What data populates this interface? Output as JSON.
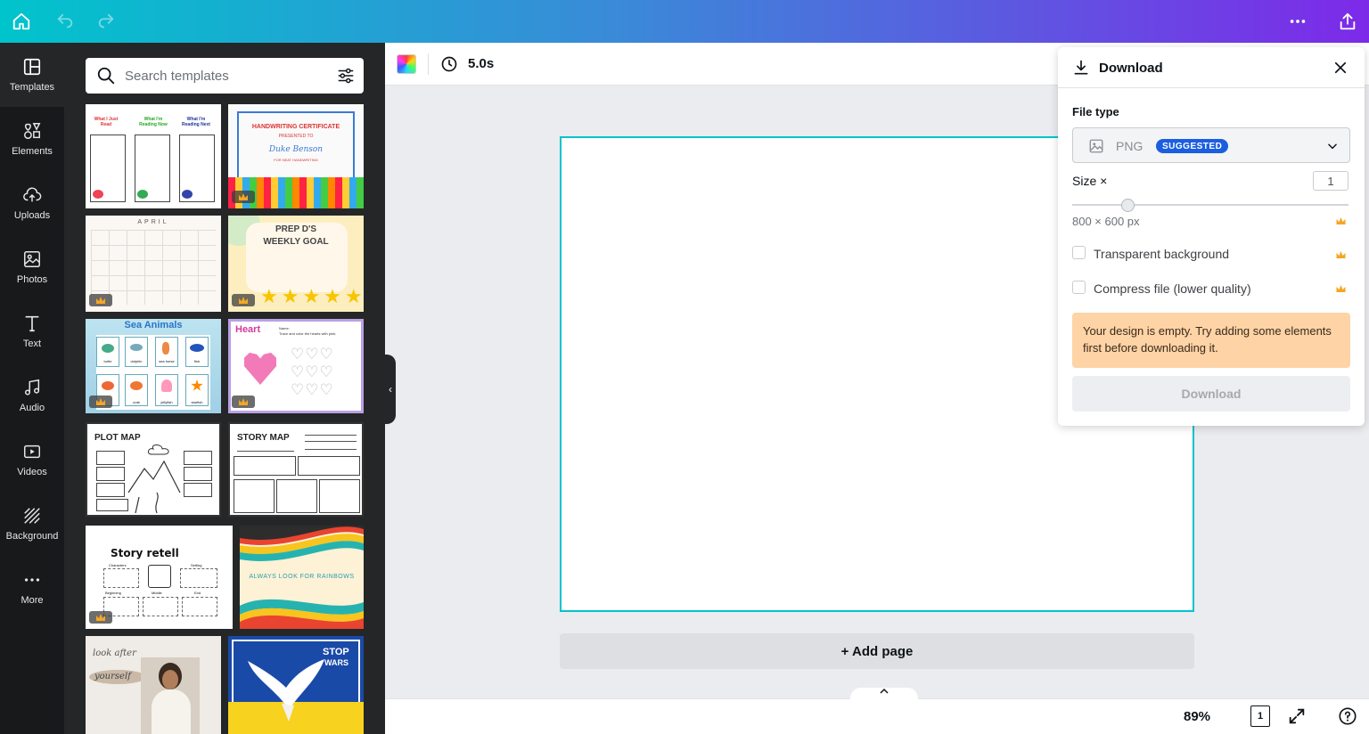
{
  "topbar": {
    "icons": [
      "home-icon",
      "undo-icon",
      "redo-icon",
      "more-icon",
      "share-icon"
    ]
  },
  "rail": {
    "items": [
      {
        "label": "Templates",
        "icon": "templates-icon",
        "active": true
      },
      {
        "label": "Elements",
        "icon": "elements-icon"
      },
      {
        "label": "Uploads",
        "icon": "uploads-icon"
      },
      {
        "label": "Photos",
        "icon": "photos-icon"
      },
      {
        "label": "Text",
        "icon": "text-icon"
      },
      {
        "label": "Audio",
        "icon": "audio-icon"
      },
      {
        "label": "Videos",
        "icon": "videos-icon"
      },
      {
        "label": "Background",
        "icon": "background-icon"
      },
      {
        "label": "More",
        "icon": "more-icon"
      }
    ]
  },
  "search": {
    "placeholder": "Search templates"
  },
  "templates": {
    "reading": {
      "col1": "What I Just Read",
      "col2": "What I'm Reading Now",
      "col3": "What I'm Reading Next"
    },
    "certificate": {
      "title": "HANDWRITING CERTIFICATE",
      "sub": "PRESENTED TO",
      "name": "Duke Benson",
      "reason": "FOR NEAT HANDWRITING"
    },
    "calendar": {
      "month": "APRIL"
    },
    "weekly": {
      "title1": "PREP D'S",
      "title2": "WEEKLY GOAL"
    },
    "sea": {
      "title": "Sea Animals",
      "labels": [
        "turtle",
        "dolphin",
        "sea horse",
        "fish",
        "crab",
        "crab",
        "jellyfish",
        "starfish"
      ]
    },
    "heart": {
      "title": "Heart",
      "instruction": "Trace and color the hearts with pink.",
      "name_label": "Name:"
    },
    "plotmap": {
      "title": "PLOT MAP"
    },
    "storymap": {
      "title": "STORY MAP"
    },
    "retell": {
      "title": "Story retell",
      "labels": [
        "Characters",
        "Setting",
        "Beginning",
        "Middle",
        "End"
      ]
    },
    "rainbow": {
      "text": "ALWAYS LOOK FOR RAINBOWS"
    },
    "lookafter": {
      "line1": "look after",
      "line2": "yourself"
    },
    "stopwars": {
      "line1": "STOP",
      "line2": "WARS"
    }
  },
  "editor": {
    "duration": "5.0s",
    "add_page": "+ Add page",
    "zoom": "89%",
    "page_count": "1"
  },
  "download": {
    "title": "Download",
    "file_type_label": "File type",
    "file_type_value": "PNG",
    "suggested_badge": "SUGGESTED",
    "size_label": "Size ×",
    "size_value": "1",
    "size_fraction": 0.2,
    "dimensions": "800 × 600 px",
    "transparent_label": "Transparent background",
    "compress_label": "Compress file (lower quality)",
    "warning": "Your design is empty. Try adding some elements first before downloading it.",
    "button": "Download"
  },
  "colors": {
    "accent": "#00c4cc",
    "brand_start": "#00c4cc",
    "brand_end": "#7d2ae8",
    "crown": "#f5a623",
    "badge": "#1b5fe0",
    "warning_bg": "#fed3a6"
  }
}
